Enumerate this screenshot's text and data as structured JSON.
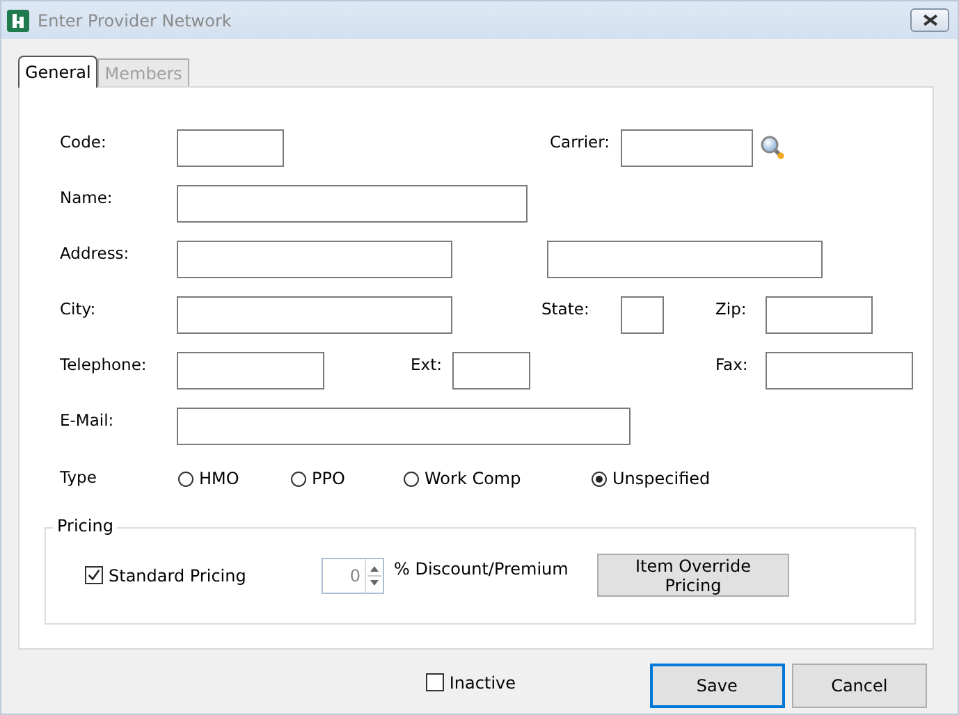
{
  "window": {
    "title": "Enter Provider Network"
  },
  "tabs": [
    {
      "label": "General",
      "selected": true,
      "disabled": false
    },
    {
      "label": "Members",
      "selected": false,
      "disabled": true
    }
  ],
  "fields": {
    "code": {
      "label": "Code:"
    },
    "carrier": {
      "label": "Carrier:"
    },
    "name": {
      "label": "Name:"
    },
    "address": {
      "label": "Address:"
    },
    "city": {
      "label": "City:"
    },
    "state": {
      "label": "State:"
    },
    "zip": {
      "label": "Zip:"
    },
    "telephone": {
      "label": "Telephone:"
    },
    "ext": {
      "label": "Ext:"
    },
    "fax": {
      "label": "Fax:"
    },
    "email": {
      "label": "E-Mail:"
    }
  },
  "type": {
    "label": "Type",
    "options": [
      {
        "label": "HMO",
        "selected": false
      },
      {
        "label": "PPO",
        "selected": false
      },
      {
        "label": "Work Comp",
        "selected": false
      },
      {
        "label": "Unspecified",
        "selected": true
      }
    ]
  },
  "pricing": {
    "legend": "Pricing",
    "standard_pricing": {
      "label": "Standard Pricing",
      "checked": true
    },
    "discount": {
      "value": "0",
      "label": "% Discount/Premium"
    },
    "override_button": "Item Override Pricing"
  },
  "inactive": {
    "label": "Inactive",
    "checked": false
  },
  "buttons": [
    {
      "label": "Save",
      "default": true
    },
    {
      "label": "Cancel",
      "default": false
    }
  ]
}
